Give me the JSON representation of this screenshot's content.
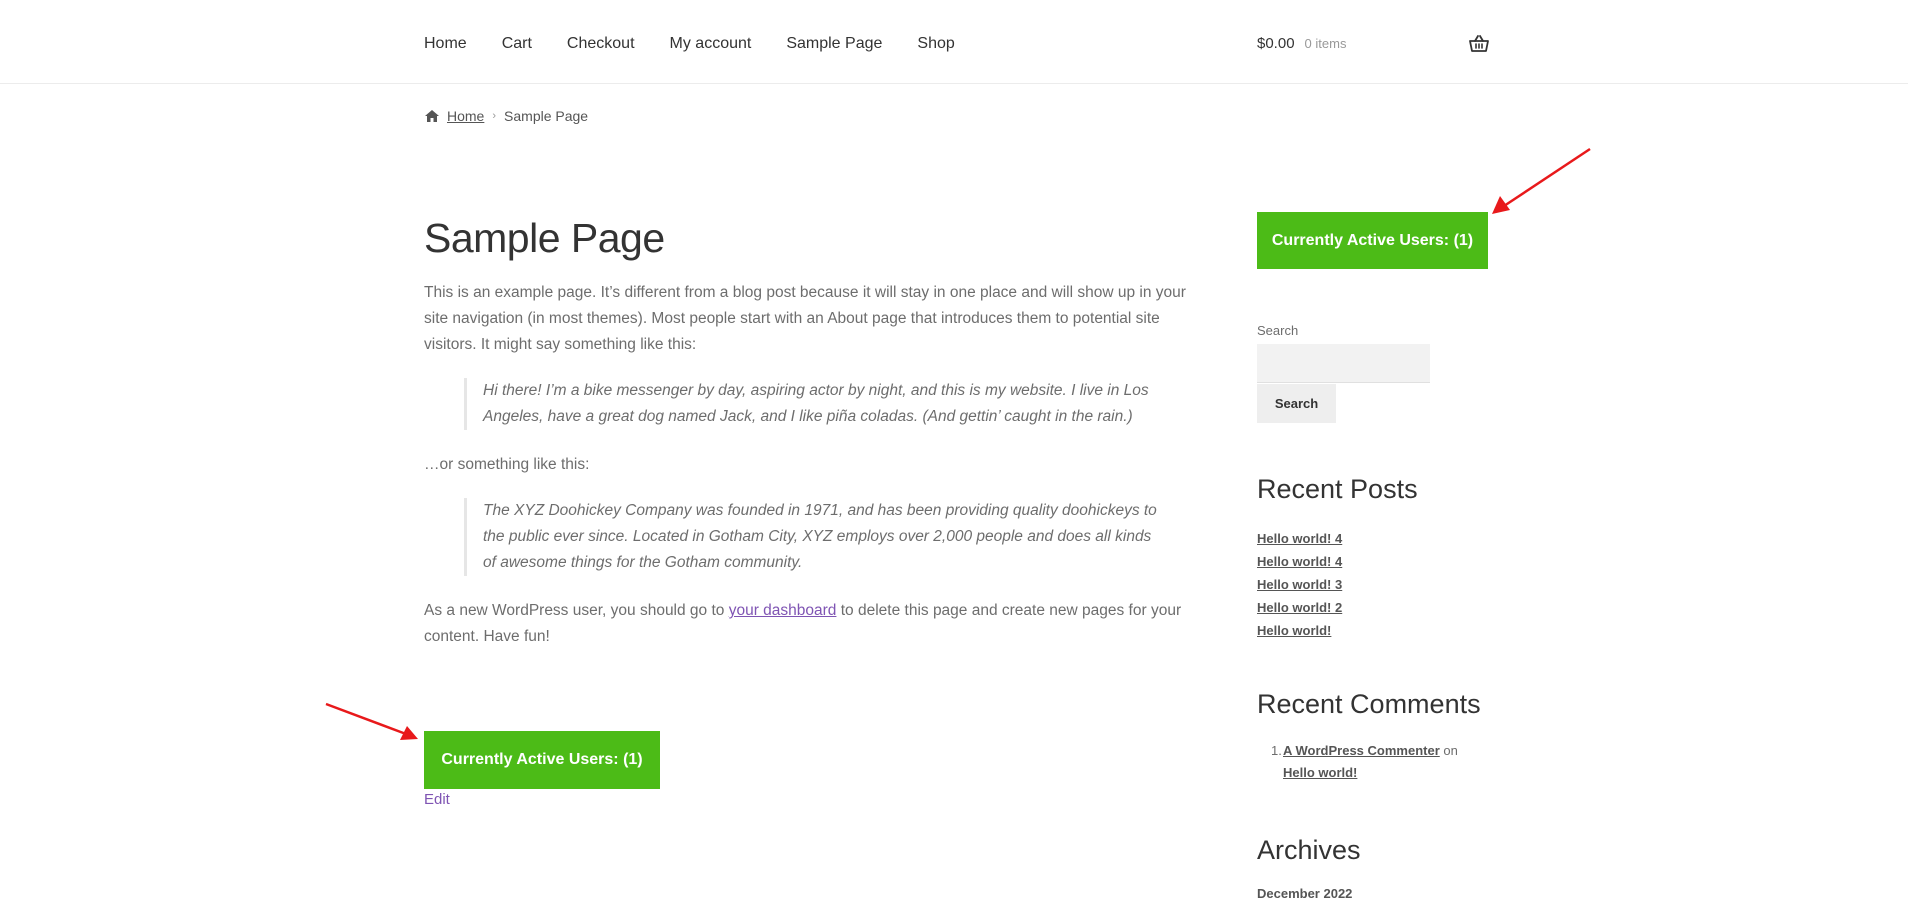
{
  "nav": {
    "items": [
      {
        "label": "Home"
      },
      {
        "label": "Cart"
      },
      {
        "label": "Checkout"
      },
      {
        "label": "My account"
      },
      {
        "label": "Sample Page"
      },
      {
        "label": "Shop"
      }
    ]
  },
  "cart": {
    "amount": "$0.00",
    "count": "0 items"
  },
  "breadcrumb": {
    "home": "Home",
    "separator": "›",
    "current": "Sample Page"
  },
  "page": {
    "title": "Sample Page",
    "intro": "This is an example page. It’s different from a blog post because it will stay in one place and will show up in your site navigation (in most themes). Most people start with an About page that introduces them to potential site visitors. It might say something like this:",
    "quote1": "Hi there! I’m a bike messenger by day, aspiring actor by night, and this is my website. I live in Los Angeles, have a great dog named Jack, and I like piña coladas. (And gettin’ caught in the rain.)",
    "between": "…or something like this:",
    "quote2": "The XYZ Doohickey Company was founded in 1971, and has been providing quality doohickeys to the public ever since. Located in Gotham City, XYZ employs over 2,000 people and does all kinds of awesome things for the Gotham community.",
    "wp_before": "As a new WordPress user, you should go to ",
    "wp_link": "your dashboard",
    "wp_after": " to delete this page and create new pages for your content. Have fun!",
    "active_users": "Currently Active Users: (1)",
    "edit": "Edit"
  },
  "sidebar": {
    "active_users": "Currently Active Users: (1)",
    "search_label": "Search",
    "search_button": "Search",
    "recent_posts_title": "Recent Posts",
    "recent_posts": [
      {
        "label": "Hello world! 4"
      },
      {
        "label": "Hello world! 4"
      },
      {
        "label": "Hello world! 3"
      },
      {
        "label": "Hello world! 2"
      },
      {
        "label": "Hello world!"
      }
    ],
    "recent_comments_title": "Recent Comments",
    "comment": {
      "number": "1.",
      "author": "A WordPress Commenter",
      "on": "on",
      "post": "Hello world!"
    },
    "archives_title": "Archives",
    "archive": "December 2022"
  },
  "colors": {
    "accent_green": "#4cbb17",
    "link_purple": "#7f54b3",
    "arrow_red": "#e8191b"
  },
  "icons": {
    "breadcrumb": "home-icon",
    "cart": "basket-icon"
  }
}
